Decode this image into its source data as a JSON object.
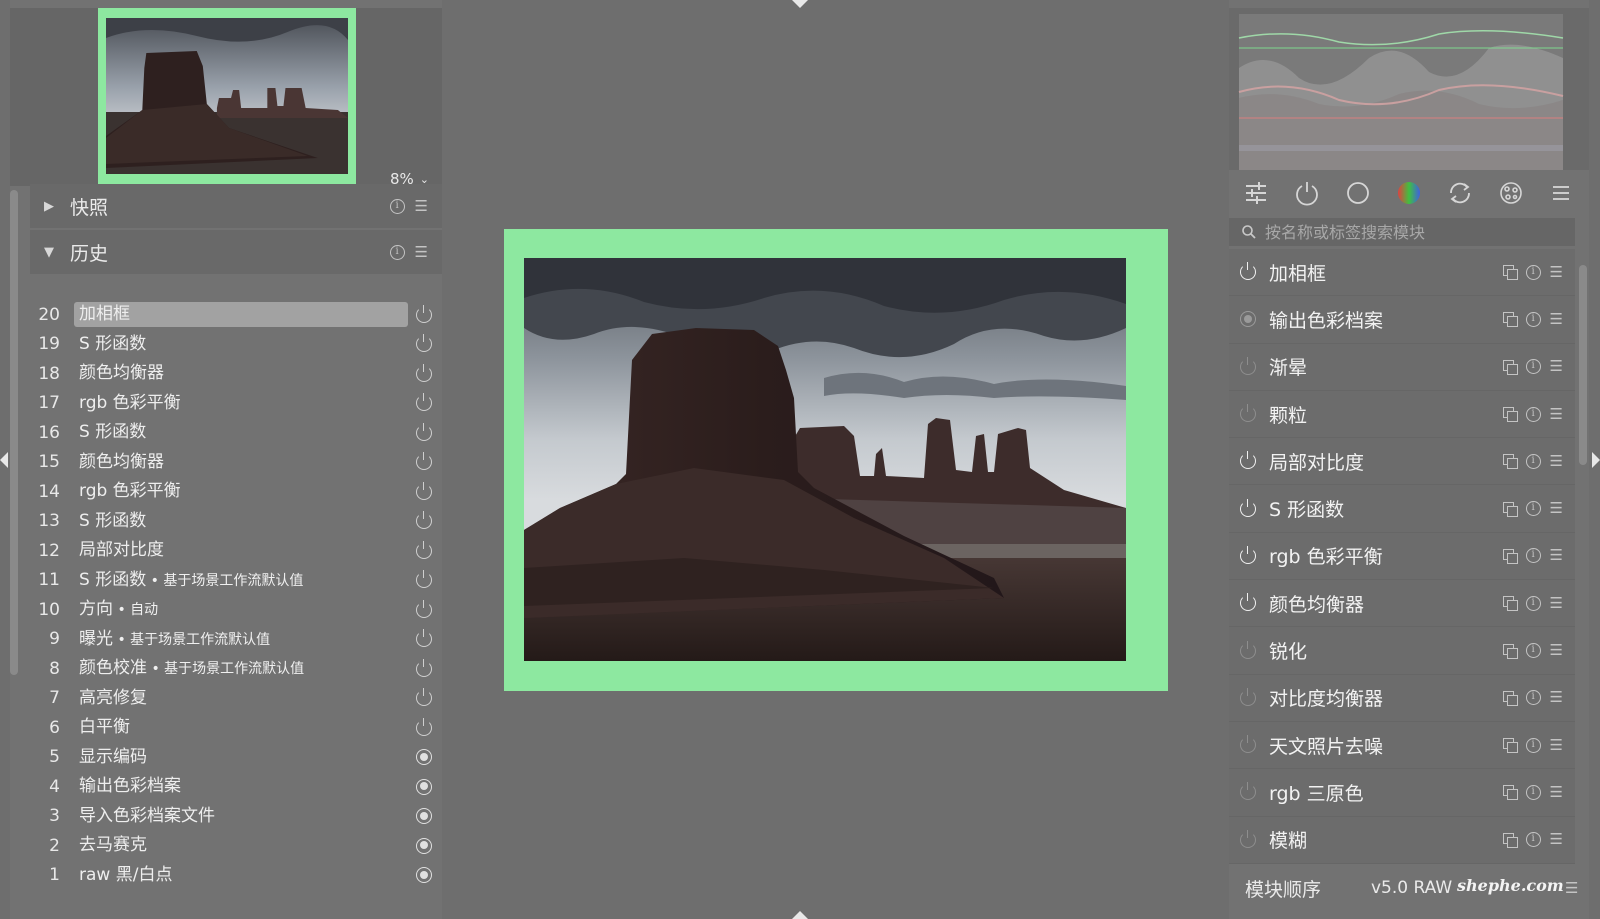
{
  "navigation": {
    "zoom": "8%"
  },
  "snapshots": {
    "title": "快照"
  },
  "history": {
    "title": "历史",
    "items": [
      {
        "num": "20",
        "label": "加相框",
        "sub": "",
        "state": "power",
        "selected": true
      },
      {
        "num": "19",
        "label": "S 形函数",
        "sub": "",
        "state": "power"
      },
      {
        "num": "18",
        "label": "颜色均衡器",
        "sub": "",
        "state": "power"
      },
      {
        "num": "17",
        "label": "rgb 色彩平衡",
        "sub": "",
        "state": "power"
      },
      {
        "num": "16",
        "label": "S 形函数",
        "sub": "",
        "state": "power"
      },
      {
        "num": "15",
        "label": "颜色均衡器",
        "sub": "",
        "state": "power"
      },
      {
        "num": "14",
        "label": "rgb 色彩平衡",
        "sub": "",
        "state": "power"
      },
      {
        "num": "13",
        "label": "S 形函数",
        "sub": "",
        "state": "power"
      },
      {
        "num": "12",
        "label": "局部对比度",
        "sub": "",
        "state": "power"
      },
      {
        "num": "11",
        "label": "S 形函数",
        "sub": " • 基于场景工作流默认值",
        "state": "power"
      },
      {
        "num": "10",
        "label": "方向",
        "sub": " • 自动",
        "state": "power"
      },
      {
        "num": "9",
        "label": "曝光",
        "sub": " • 基于场景工作流默认值",
        "state": "power"
      },
      {
        "num": "8",
        "label": "颜色校准",
        "sub": " • 基于场景工作流默认值",
        "state": "power"
      },
      {
        "num": "7",
        "label": "高亮修复",
        "sub": "",
        "state": "power"
      },
      {
        "num": "6",
        "label": "白平衡",
        "sub": "",
        "state": "power"
      },
      {
        "num": "5",
        "label": "显示编码",
        "sub": "",
        "state": "always-on"
      },
      {
        "num": "4",
        "label": "输出色彩档案",
        "sub": "",
        "state": "always-on"
      },
      {
        "num": "3",
        "label": "导入色彩档案文件",
        "sub": "",
        "state": "always-on"
      },
      {
        "num": "2",
        "label": "去马赛克",
        "sub": "",
        "state": "always-on"
      },
      {
        "num": "1",
        "label": "raw 黑/白点",
        "sub": "",
        "state": "always-on"
      }
    ]
  },
  "module_groups": {
    "icons": [
      "quick-access-icon",
      "active-modules-icon",
      "base-modules-icon",
      "color-modules-icon",
      "correct-modules-icon",
      "effect-modules-icon",
      "presets-menu-icon"
    ]
  },
  "search": {
    "placeholder": "按名称或标签搜索模块"
  },
  "modules": [
    {
      "label": "加相框",
      "power": "on"
    },
    {
      "label": "输出色彩档案",
      "power": "fixed"
    },
    {
      "label": "渐晕",
      "power": "off"
    },
    {
      "label": "颗粒",
      "power": "off"
    },
    {
      "label": "局部对比度",
      "power": "on"
    },
    {
      "label": "S 形函数",
      "power": "on"
    },
    {
      "label": "rgb 色彩平衡",
      "power": "on"
    },
    {
      "label": "颜色均衡器",
      "power": "on"
    },
    {
      "label": "锐化",
      "power": "off"
    },
    {
      "label": "对比度均衡器",
      "power": "off"
    },
    {
      "label": "天文照片去噪",
      "power": "off"
    },
    {
      "label": "rgb 三原色",
      "power": "off"
    },
    {
      "label": "模糊",
      "power": "off"
    }
  ],
  "footer": {
    "order_label": "模块顺序",
    "order_value": "v5.0 RAW",
    "watermark": "shephe.com"
  },
  "colors": {
    "frame": "#8de8a0",
    "background": "#6e6e6e",
    "panel": "#727272"
  }
}
